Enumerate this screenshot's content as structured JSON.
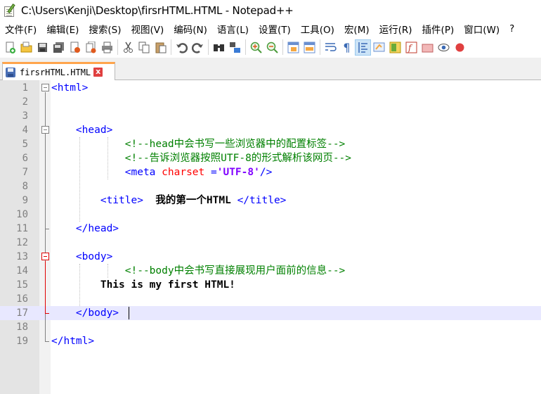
{
  "window": {
    "title": "C:\\Users\\Kenji\\Desktop\\firsrHTML.HTML - Notepad++"
  },
  "menu": [
    "文件(F)",
    "编辑(E)",
    "搜索(S)",
    "视图(V)",
    "编码(N)",
    "语言(L)",
    "设置(T)",
    "工具(O)",
    "宏(M)",
    "运行(R)",
    "插件(P)",
    "窗口(W)",
    "?"
  ],
  "toolbar": {
    "icons": [
      "new-file",
      "open-file",
      "save",
      "save-all",
      "close",
      "close-all",
      "print",
      "cut",
      "copy",
      "paste",
      "undo",
      "redo",
      "find",
      "replace",
      "zoom-in",
      "zoom-out",
      "sync-vertical",
      "sync-horizontal",
      "word-wrap",
      "show-all-chars",
      "indent-guide",
      "user-defined-language",
      "document-map",
      "function-list",
      "folder-as-workspace",
      "monitoring",
      "record-macro"
    ]
  },
  "tab": {
    "label": "firsrHTML.HTML",
    "close": "x"
  },
  "editor": {
    "current_line": 17,
    "lines": [
      {
        "n": "1",
        "tokens": [
          {
            "t": "tag",
            "v": "<html>"
          }
        ]
      },
      {
        "n": "2",
        "tokens": []
      },
      {
        "n": "3",
        "tokens": []
      },
      {
        "n": "4",
        "tokens": [
          {
            "t": "plain",
            "v": "    "
          },
          {
            "t": "tag",
            "v": "<head>"
          }
        ]
      },
      {
        "n": "5",
        "tokens": [
          {
            "t": "plain",
            "v": "            "
          },
          {
            "t": "cmt",
            "v": "<!--head中会书写一些浏览器中的配置标签-->"
          }
        ]
      },
      {
        "n": "6",
        "tokens": [
          {
            "t": "plain",
            "v": "            "
          },
          {
            "t": "cmt",
            "v": "<!--告诉浏览器按照UTF-8的形式解析该网页-->"
          }
        ]
      },
      {
        "n": "7",
        "tokens": [
          {
            "t": "plain",
            "v": "            "
          },
          {
            "t": "tag",
            "v": "<meta "
          },
          {
            "t": "attr",
            "v": "charset"
          },
          {
            "t": "tag",
            "v": " ="
          },
          {
            "t": "val",
            "v": "'UTF-8'"
          },
          {
            "t": "tag",
            "v": "/>"
          }
        ]
      },
      {
        "n": "8",
        "tokens": []
      },
      {
        "n": "9",
        "tokens": [
          {
            "t": "plain",
            "v": "        "
          },
          {
            "t": "tag",
            "v": "<title>"
          },
          {
            "t": "txt",
            "v": "  我的第一个HTML "
          },
          {
            "t": "tag",
            "v": "</title>"
          }
        ]
      },
      {
        "n": "10",
        "tokens": []
      },
      {
        "n": "11",
        "tokens": [
          {
            "t": "plain",
            "v": "    "
          },
          {
            "t": "tag",
            "v": "</head>"
          }
        ]
      },
      {
        "n": "12",
        "tokens": []
      },
      {
        "n": "13",
        "tokens": [
          {
            "t": "plain",
            "v": "    "
          },
          {
            "t": "tag",
            "v": "<body>"
          }
        ]
      },
      {
        "n": "14",
        "tokens": [
          {
            "t": "plain",
            "v": "            "
          },
          {
            "t": "cmt",
            "v": "<!--body中会书写直接展现用户面前的信息-->"
          }
        ]
      },
      {
        "n": "15",
        "tokens": [
          {
            "t": "plain",
            "v": "        "
          },
          {
            "t": "txt",
            "v": "This is my first HTML!"
          }
        ]
      },
      {
        "n": "16",
        "tokens": []
      },
      {
        "n": "17",
        "tokens": [
          {
            "t": "plain",
            "v": "    "
          },
          {
            "t": "tag",
            "v": "</body>"
          }
        ]
      },
      {
        "n": "18",
        "tokens": []
      },
      {
        "n": "19",
        "tokens": [
          {
            "t": "tag",
            "v": "</html>"
          }
        ]
      }
    ]
  },
  "colors": {
    "tag": "#0000ff",
    "comment": "#008000",
    "attribute": "#ff0000",
    "attr_value": "#8000ff",
    "text": "#000000",
    "current_line_bg": "#e8e8ff",
    "tab_accent": "#ffa54c"
  }
}
